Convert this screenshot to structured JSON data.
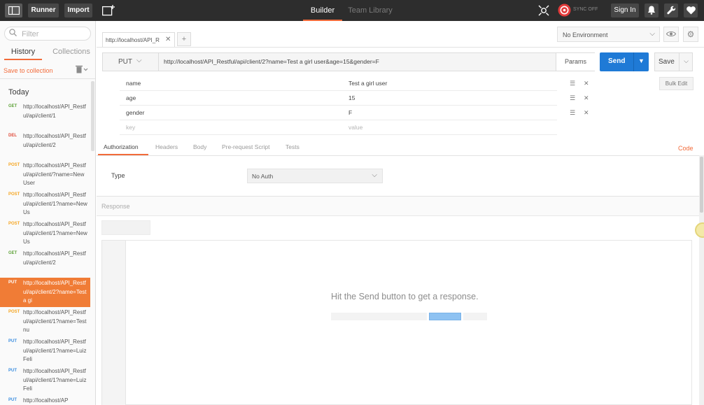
{
  "topbar": {
    "runner_label": "Runner",
    "import_label": "Import",
    "tabs": [
      {
        "label": "Builder",
        "active": true
      },
      {
        "label": "Team Library",
        "active": false
      }
    ],
    "sync_label": "SYNC OFF",
    "sign_in_label": "Sign In",
    "icons": [
      "sidebar-toggle-icon",
      "new-tab-icon",
      "interceptor-icon",
      "sync-icon",
      "bell-icon",
      "wrench-icon",
      "heart-icon"
    ]
  },
  "sidebar": {
    "filter_placeholder": "Filter",
    "tabs": [
      {
        "label": "History",
        "active": true
      },
      {
        "label": "Collections",
        "active": false
      }
    ],
    "save_to_collection": "Save to collection",
    "section_title": "Today",
    "history": [
      {
        "method": "GET",
        "url": "http://localhost/API_Restful/api/client/1",
        "selected": false
      },
      {
        "method": "DEL",
        "url": "http://localhost/API_Restful/api/client/2",
        "selected": false
      },
      {
        "method": "POST",
        "url": "http://localhost/API_Restful/api/client/?name=New User",
        "selected": false
      },
      {
        "method": "POST",
        "url": "http://localhost/API_Restful/api/client/1?name=New Us",
        "selected": false
      },
      {
        "method": "POST",
        "url": "http://localhost/API_Restful/api/client/1?name=New Us",
        "selected": false
      },
      {
        "method": "GET",
        "url": "http://localhost/API_Restful/api/client/2",
        "selected": false
      },
      {
        "method": "PUT",
        "url": "http://localhost/API_Restful/api/client/2?name=Test a gi",
        "selected": true
      },
      {
        "method": "POST",
        "url": "http://localhost/API_Restful/api/client/1?name=Test nu",
        "selected": false
      },
      {
        "method": "PUT",
        "url": "http://localhost/API_Restful/api/client/1?name=Luiz Feli",
        "selected": false
      },
      {
        "method": "PUT",
        "url": "http://localhost/API_Restful/api/client/1?name=Luiz Feli",
        "selected": false
      },
      {
        "method": "PUT",
        "url": "http://localhost/AP",
        "selected": false
      }
    ]
  },
  "request_tab": {
    "label": "http://localhost/API_R"
  },
  "environment": {
    "selected": "No Environment"
  },
  "request": {
    "method": "PUT",
    "url": "http://localhost/API_Restful/api/client/2?name=Test a girl user&age=15&gender=F",
    "params_label": "Params",
    "send_label": "Send",
    "save_label": "Save"
  },
  "params": {
    "rows": [
      {
        "key": "name",
        "value": "Test a girl user"
      },
      {
        "key": "age",
        "value": "15"
      },
      {
        "key": "gender",
        "value": "F"
      }
    ],
    "key_placeholder": "key",
    "value_placeholder": "value",
    "bulk_edit_label": "Bulk Edit"
  },
  "subtabs": [
    {
      "label": "Authorization",
      "active": true
    },
    {
      "label": "Headers",
      "active": false
    },
    {
      "label": "Body",
      "active": false
    },
    {
      "label": "Pre-request Script",
      "active": false
    },
    {
      "label": "Tests",
      "active": false
    }
  ],
  "code_label": "Code",
  "auth": {
    "type_label": "Type",
    "type_value": "No Auth"
  },
  "response": {
    "title": "Response",
    "hint": "Hit the Send button to get a response."
  },
  "colors": {
    "accent": "#f26b3a",
    "send_blue": "#1f7ad6",
    "topbar": "#2d2d2d",
    "get": "#5fa33a",
    "delete": "#e04b3a",
    "post": "#f5a623",
    "put": "#3b8ee0"
  }
}
